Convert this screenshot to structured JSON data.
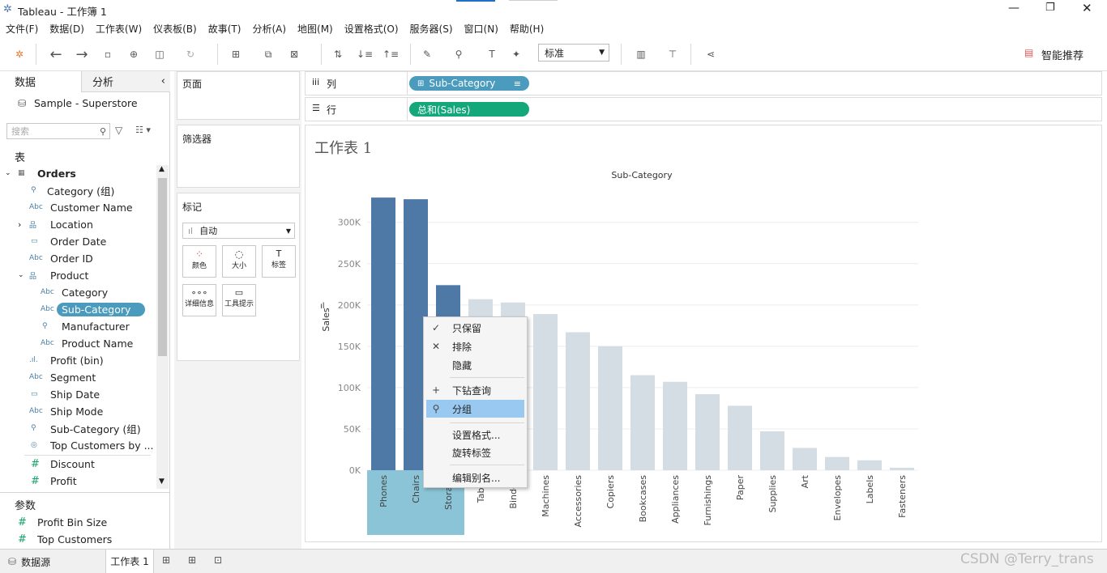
{
  "window": {
    "title": "Tableau - 工作簿 1"
  },
  "menu": [
    "文件(F)",
    "数据(D)",
    "工作表(W)",
    "仪表板(B)",
    "故事(T)",
    "分析(A)",
    "地图(M)",
    "设置格式(O)",
    "服务器(S)",
    "窗口(N)",
    "帮助(H)"
  ],
  "toolbar": {
    "fit_value": "标准",
    "smart_label": "智能推荐"
  },
  "datapane": {
    "tab_data": "数据",
    "tab_analysis": "分析",
    "datasource": "Sample - Superstore",
    "search_placeholder": "搜索",
    "tables_label": "表",
    "params_label": "参数",
    "fields": [
      {
        "name": "Orders",
        "icon": "table",
        "bold": true
      },
      {
        "name": "Category (组)",
        "icon": "clip"
      },
      {
        "name": "Customer Name",
        "icon": "Abc"
      },
      {
        "name": "Location",
        "icon": "hier"
      },
      {
        "name": "Order Date",
        "icon": "cal"
      },
      {
        "name": "Order ID",
        "icon": "Abc"
      },
      {
        "name": "Product",
        "icon": "hier"
      },
      {
        "name": "Category",
        "icon": "Abc"
      },
      {
        "name": "Sub-Category",
        "icon": "Abc",
        "selected": true
      },
      {
        "name": "Manufacturer",
        "icon": "clip"
      },
      {
        "name": "Product Name",
        "icon": "Abc"
      },
      {
        "name": "Profit (bin)",
        "icon": "bin"
      },
      {
        "name": "Segment",
        "icon": "Abc"
      },
      {
        "name": "Ship Date",
        "icon": "cal"
      },
      {
        "name": "Ship Mode",
        "icon": "Abc"
      },
      {
        "name": "Sub-Category (组)",
        "icon": "clip"
      },
      {
        "name": "Top Customers by ...",
        "icon": "set"
      },
      {
        "name": "Discount",
        "icon": "#"
      },
      {
        "name": "Profit",
        "icon": "#"
      }
    ],
    "params": [
      "Profit Bin Size",
      "Top Customers"
    ]
  },
  "cards": {
    "pages": "页面",
    "filters": "筛选器",
    "marks": "标记",
    "mark_type": "自动",
    "mark_buttons": [
      "颜色",
      "大小",
      "标签",
      "详细信息",
      "工具提示"
    ]
  },
  "shelves": {
    "columns_label": "列",
    "rows_label": "行",
    "columns_pill": "Sub-Category",
    "rows_pill": "总和(Sales)"
  },
  "sheet_title": "工作表 1",
  "chart_data": {
    "type": "bar",
    "title": "",
    "xheader": "Sub-Category",
    "ylabel": "Sales",
    "ylim": [
      0,
      335000
    ],
    "yticks": [
      0,
      50000,
      100000,
      150000,
      200000,
      250000,
      300000
    ],
    "ytick_labels": [
      "0K",
      "50K",
      "100K",
      "150K",
      "200K",
      "250K",
      "300K"
    ],
    "grid": true,
    "categories": [
      "Phones",
      "Chairs",
      "Storage",
      "Tables",
      "Binders",
      "Machines",
      "Accessories",
      "Copiers",
      "Bookcases",
      "Appliances",
      "Furnishings",
      "Paper",
      "Supplies",
      "Art",
      "Envelopes",
      "Labels",
      "Fasteners"
    ],
    "values": [
      330000,
      328000,
      224000,
      207000,
      203000,
      189000,
      167000,
      150000,
      115000,
      107000,
      92000,
      78000,
      47000,
      27000,
      16000,
      12000,
      3000
    ],
    "selected": [
      true,
      true,
      true,
      false,
      false,
      false,
      false,
      false,
      false,
      false,
      false,
      false,
      false,
      false,
      false,
      false,
      false
    ],
    "colors": {
      "selected": "#4e79a7",
      "unselected": "#d4dce4",
      "highlight": "#8bc4d6",
      "grid": "#ececec"
    }
  },
  "context_menu": [
    {
      "label": "只保留",
      "icon": "✓"
    },
    {
      "label": "排除",
      "icon": "✕"
    },
    {
      "label": "隐藏",
      "icon": ""
    },
    {
      "label": "下钻查询",
      "icon": "+"
    },
    {
      "label": "分组",
      "icon": "⚲",
      "highlight": true
    },
    {
      "label": "设置格式...",
      "icon": ""
    },
    {
      "label": "旋转标签",
      "icon": ""
    },
    {
      "label": "编辑别名...",
      "icon": ""
    }
  ],
  "bottom": {
    "datasource_tab": "数据源",
    "sheet_tab": "工作表 1"
  },
  "watermark": "CSDN @Terry_trans"
}
